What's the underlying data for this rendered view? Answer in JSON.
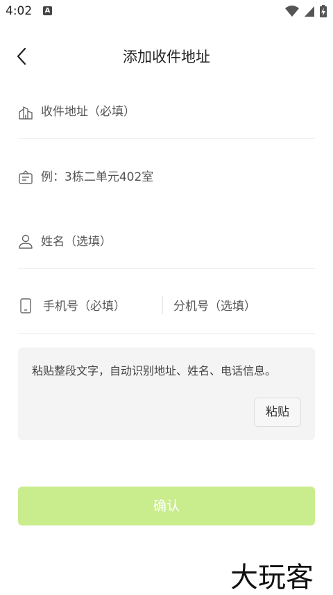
{
  "status_bar": {
    "time": "4:02",
    "notification_badge": "A",
    "icons": [
      "wifi-icon",
      "cell-signal-icon",
      "battery-charging-icon"
    ]
  },
  "header": {
    "title": "添加收件地址",
    "back_icon": "chevron-left-icon"
  },
  "form": {
    "address": {
      "placeholder": "收件地址（必填）",
      "value": "",
      "icon": "building-icon"
    },
    "detail": {
      "placeholder": "例：3栋二单元402室",
      "value": "",
      "icon": "door-plate-icon"
    },
    "name": {
      "placeholder": "姓名（选填）",
      "value": "",
      "icon": "person-icon"
    },
    "phone": {
      "placeholder": "手机号（必填）",
      "value": "",
      "icon": "phone-icon"
    },
    "extension": {
      "placeholder": "分机号（选填）",
      "value": ""
    }
  },
  "paste": {
    "placeholder": "粘贴整段文字，自动识别地址、姓名、电话信息。",
    "button_label": "粘贴"
  },
  "confirm": {
    "label": "确认"
  },
  "watermark": "大玩客",
  "colors": {
    "confirm_bg": "#c9ec8d",
    "paste_bg": "#f4f4f5",
    "divider": "#efefef"
  }
}
